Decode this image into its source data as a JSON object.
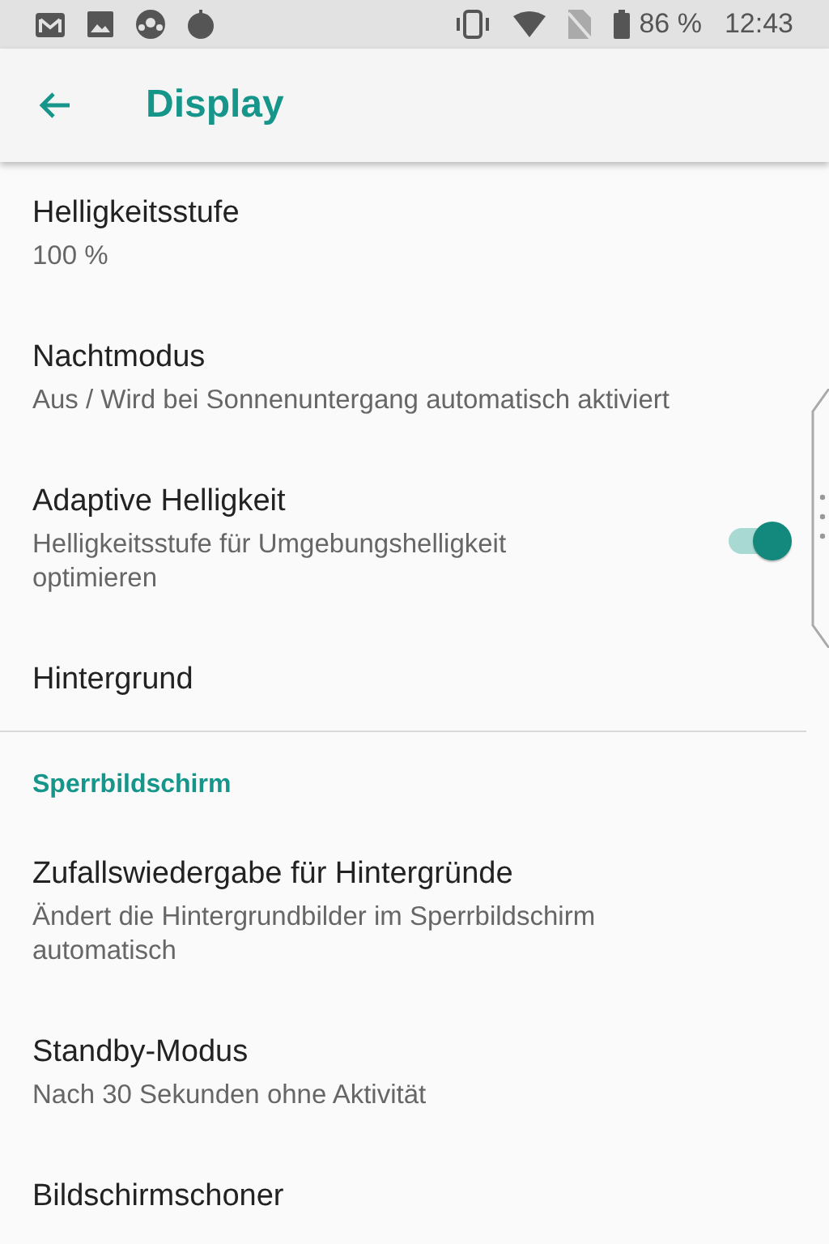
{
  "status_bar": {
    "battery": "86 %",
    "time": "12:43"
  },
  "app_bar": {
    "title": "Display"
  },
  "items": [
    {
      "kind": "setting",
      "title": "Helligkeitsstufe",
      "summary": "100 %"
    },
    {
      "kind": "setting",
      "title": "Nachtmodus",
      "summary": "Aus / Wird bei Sonnenuntergang automatisch aktiviert"
    },
    {
      "kind": "toggle",
      "title": "Adaptive Helligkeit",
      "summary": "Helligkeitsstufe für Umgebungshelligkeit optimieren",
      "on": true
    },
    {
      "kind": "setting",
      "title": "Hintergrund"
    },
    {
      "kind": "header",
      "title": "Sperrbildschirm"
    },
    {
      "kind": "setting",
      "title": "Zufallswiedergabe für Hintergründe",
      "summary": "Ändert die Hintergrundbilder im Sperrbildschirm automatisch"
    },
    {
      "kind": "setting",
      "title": "Standby-Modus",
      "summary": "Nach 30 Sekunden ohne Aktivität"
    },
    {
      "kind": "setting",
      "title": "Bildschirmschoner"
    }
  ]
}
